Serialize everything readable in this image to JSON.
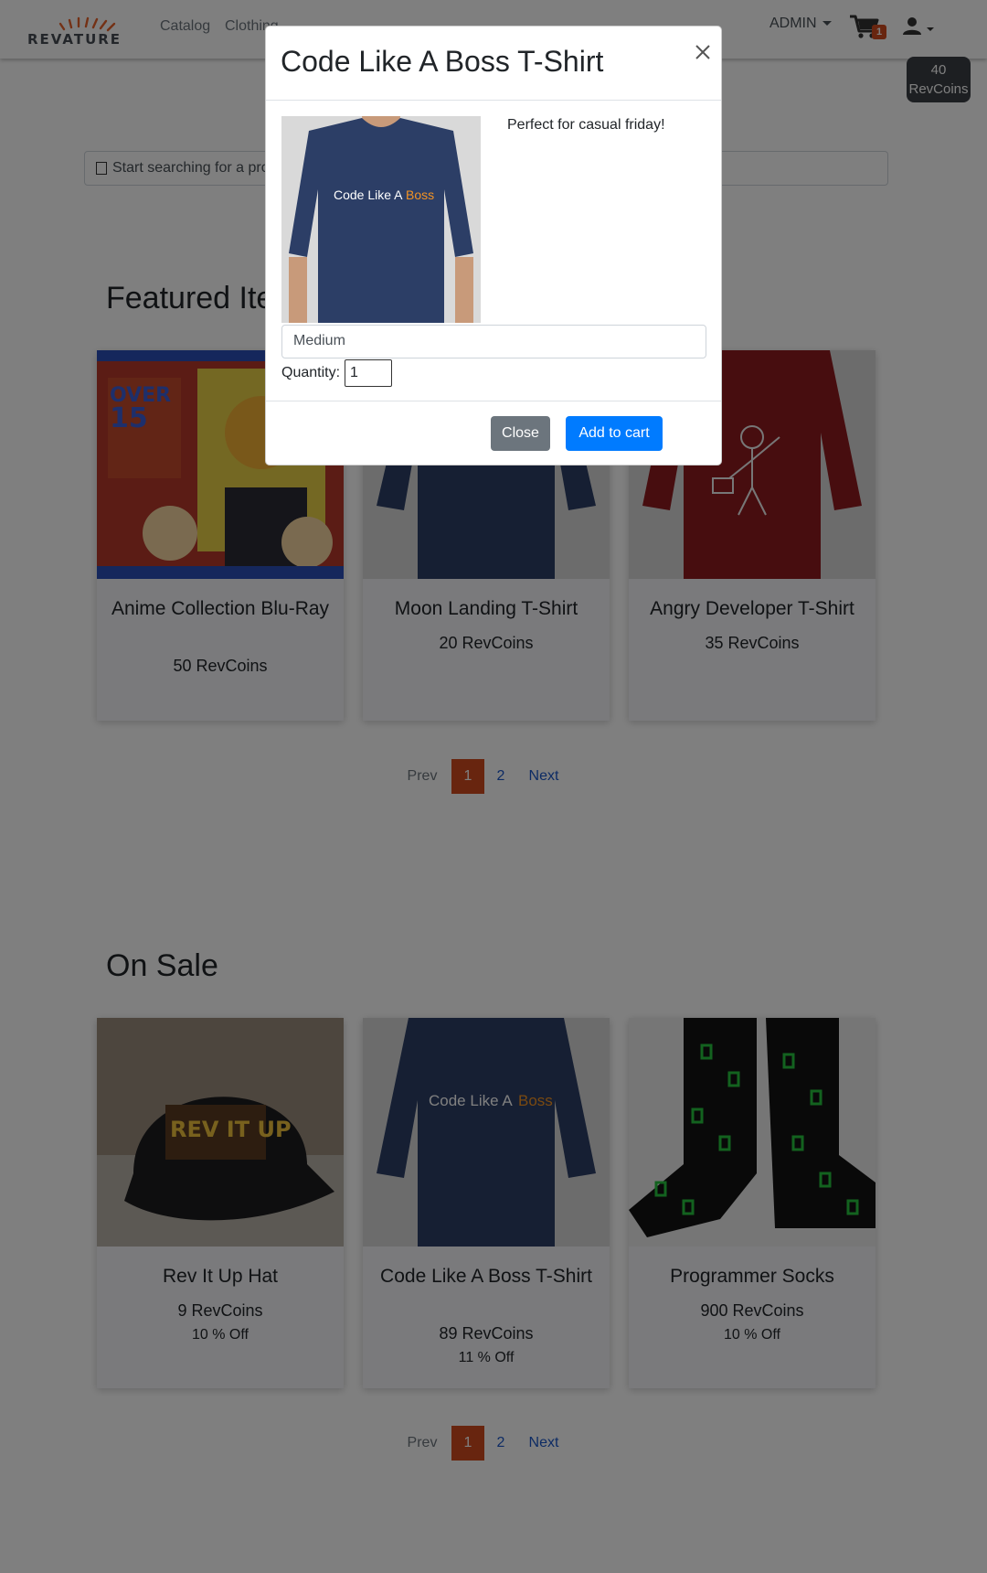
{
  "navbar": {
    "logo_text": "REVATURE",
    "links": [
      "Catalog",
      "Clothing"
    ],
    "admin_label": "ADMIN",
    "cart_count": "1",
    "coins_amount": "40",
    "coins_unit": "RevCoins"
  },
  "search": {
    "placeholder": "Start searching for a product"
  },
  "featured": {
    "title": "Featured Items",
    "items": [
      {
        "name": "Anime Collection Blu-Ray",
        "price": "50 RevCoins",
        "image": "anime-bluray-image"
      },
      {
        "name": "Moon Landing T-Shirt",
        "price": "20 RevCoins",
        "image": "navy-tshirt-image"
      },
      {
        "name": "Angry Developer T-Shirt",
        "price": "35 RevCoins",
        "image": "red-tshirt-image"
      }
    ],
    "pager": {
      "prev": "Prev",
      "page1": "1",
      "page2": "2",
      "next": "Next"
    }
  },
  "on_sale": {
    "title": "On Sale",
    "items": [
      {
        "name": "Rev It Up Hat",
        "price": "9 RevCoins",
        "discount": "10 % Off"
      },
      {
        "name": "Code Like A Boss T-Shirt",
        "price": "89 RevCoins",
        "discount": "11 % Off"
      },
      {
        "name": "Programmer Socks",
        "price": "900 RevCoins",
        "discount": "10 % Off"
      }
    ],
    "pager": {
      "prev": "Prev",
      "page1": "1",
      "page2": "2",
      "next": "Next"
    }
  },
  "modal": {
    "title": "Code Like A Boss T-Shirt",
    "description": "Perfect for casual friday!",
    "shirt_text_a": "Code Like A",
    "shirt_text_b": "Boss",
    "size_value": "Medium",
    "quantity_label": "Quantity:",
    "quantity_value": "1",
    "close_label": "Close",
    "add_label": "Add to cart"
  },
  "colors": {
    "accent": "#d04a1f",
    "primary": "#007bff",
    "secondary": "#6c757d",
    "overlay": "rgba(0,0,0,0.5)"
  }
}
